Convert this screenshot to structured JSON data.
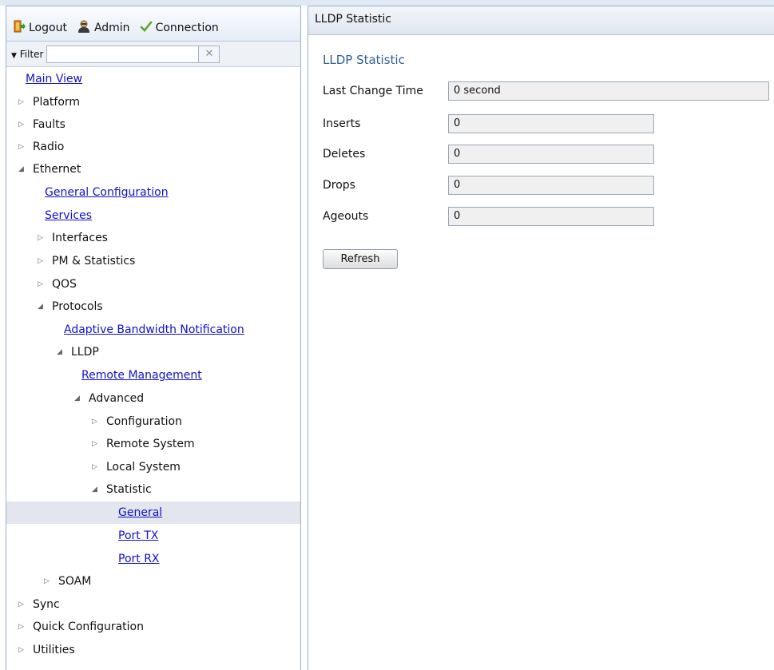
{
  "toolbar": {
    "logout": "Logout",
    "admin": "Admin",
    "connection": "Connection"
  },
  "filter": {
    "label": "Filter",
    "value": "",
    "clear_icon": "close-icon"
  },
  "tree": [
    {
      "label": "Main View",
      "link": true,
      "arrow": ""
    },
    {
      "label": "Platform",
      "link": false,
      "arrow": "collapsed"
    },
    {
      "label": "Faults",
      "link": false,
      "arrow": "collapsed"
    },
    {
      "label": "Radio",
      "link": false,
      "arrow": "collapsed"
    },
    {
      "label": "Ethernet",
      "link": false,
      "arrow": "expanded"
    },
    {
      "label": "General Configuration",
      "link": true,
      "arrow": ""
    },
    {
      "label": "Services",
      "link": true,
      "arrow": ""
    },
    {
      "label": "Interfaces",
      "link": false,
      "arrow": "collapsed"
    },
    {
      "label": "PM & Statistics",
      "link": false,
      "arrow": "collapsed"
    },
    {
      "label": "QOS",
      "link": false,
      "arrow": "collapsed"
    },
    {
      "label": "Protocols",
      "link": false,
      "arrow": "expanded"
    },
    {
      "label": "Adaptive Bandwidth Notification",
      "link": true,
      "arrow": ""
    },
    {
      "label": "LLDP",
      "link": false,
      "arrow": "expanded"
    },
    {
      "label": "Remote Management",
      "link": true,
      "arrow": ""
    },
    {
      "label": "Advanced",
      "link": false,
      "arrow": "expanded"
    },
    {
      "label": "Configuration",
      "link": false,
      "arrow": "collapsed"
    },
    {
      "label": "Remote System",
      "link": false,
      "arrow": "collapsed"
    },
    {
      "label": "Local System",
      "link": false,
      "arrow": "collapsed"
    },
    {
      "label": "Statistic",
      "link": false,
      "arrow": "expanded"
    },
    {
      "label": "General",
      "link": true,
      "arrow": "",
      "selected": true
    },
    {
      "label": "Port TX",
      "link": true,
      "arrow": ""
    },
    {
      "label": "Port RX",
      "link": true,
      "arrow": ""
    },
    {
      "label": "SOAM",
      "link": false,
      "arrow": "collapsed"
    },
    {
      "label": "Sync",
      "link": false,
      "arrow": "collapsed"
    },
    {
      "label": "Quick Configuration",
      "link": false,
      "arrow": "collapsed"
    },
    {
      "label": "Utilities",
      "link": false,
      "arrow": "collapsed"
    }
  ],
  "main": {
    "header": "LLDP Statistic",
    "section_title": "LLDP Statistic",
    "fields": [
      {
        "label": "Last Change Time",
        "value": "0 second"
      },
      {
        "label": "Inserts",
        "value": "0"
      },
      {
        "label": "Deletes",
        "value": "0"
      },
      {
        "label": "Drops",
        "value": "0"
      },
      {
        "label": "Ageouts",
        "value": "0"
      }
    ],
    "refresh_button": "Refresh"
  }
}
